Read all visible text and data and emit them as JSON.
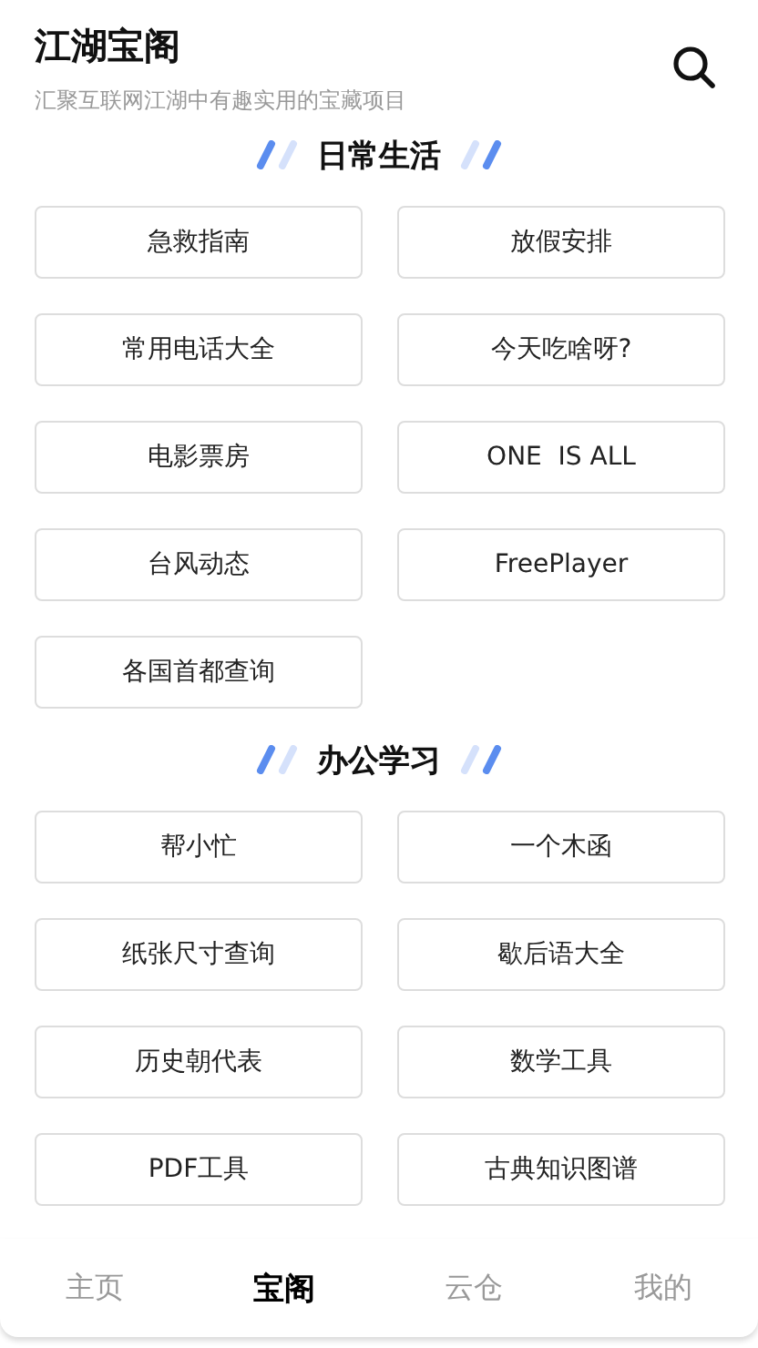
{
  "header": {
    "title": "江湖宝阁",
    "subtitle": "汇聚互联网江湖中有趣实用的宝藏项目"
  },
  "sections": [
    {
      "title": "日常生活",
      "items": [
        "急救指南",
        "放假安排",
        "常用电话大全",
        "今天吃啥呀?",
        "电影票房",
        "ONE  IS ALL",
        "台风动态",
        "FreePlayer",
        "各国首都查询"
      ]
    },
    {
      "title": "办公学习",
      "items": [
        "帮小忙",
        "一个木函",
        "纸张尺寸查询",
        "歇后语大全",
        "历史朝代表",
        "数学工具",
        "PDF工具",
        "古典知识图谱"
      ]
    }
  ],
  "tab_bar": [
    {
      "label": "主页",
      "selected": false
    },
    {
      "label": "宝阁",
      "selected": true
    },
    {
      "label": "云仓",
      "selected": false
    },
    {
      "label": "我的",
      "selected": false
    }
  ]
}
